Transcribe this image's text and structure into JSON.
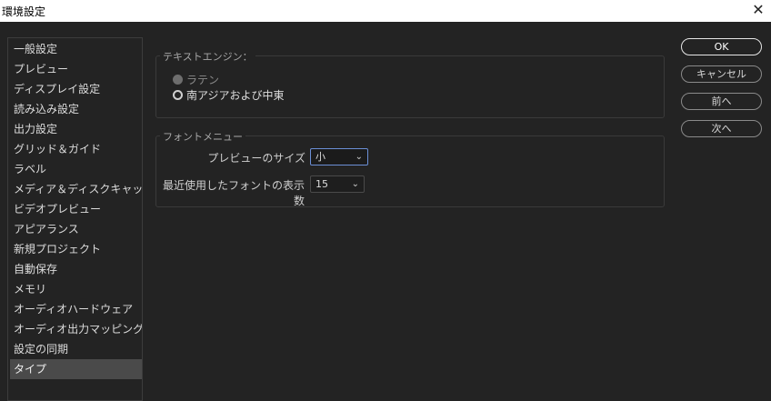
{
  "window": {
    "title": "環境設定",
    "close_glyph": "✕"
  },
  "sidebar": {
    "items": [
      {
        "label": "一般設定"
      },
      {
        "label": "プレビュー"
      },
      {
        "label": "ディスプレイ設定"
      },
      {
        "label": "読み込み設定"
      },
      {
        "label": "出力設定"
      },
      {
        "label": "グリッド＆ガイド"
      },
      {
        "label": "ラベル"
      },
      {
        "label": "メディア＆ディスクキャッシュ"
      },
      {
        "label": "ビデオプレビュー"
      },
      {
        "label": "アピアランス"
      },
      {
        "label": "新規プロジェクト"
      },
      {
        "label": "自動保存"
      },
      {
        "label": "メモリ"
      },
      {
        "label": "オーディオハードウェア"
      },
      {
        "label": "オーディオ出力マッピング"
      },
      {
        "label": "設定の同期"
      },
      {
        "label": "タイプ"
      }
    ],
    "selected": "タイプ"
  },
  "text_engine": {
    "title": "テキストエンジン：",
    "options": [
      {
        "label": "ラテン",
        "state": "disabled"
      },
      {
        "label": "南アジアおよび中東",
        "state": "unselected"
      }
    ]
  },
  "font_menu": {
    "title": "フォントメニュー",
    "preview_size_label": "プレビューのサイズ",
    "preview_size_value": "小",
    "recent_count_label": "最近使用したフォントの表示数",
    "recent_count_value": "15"
  },
  "buttons": {
    "ok": "OK",
    "cancel": "キャンセル",
    "prev": "前へ",
    "next": "次へ"
  },
  "icons": {
    "chevron": "chevron-down-icon",
    "close": "close-icon"
  }
}
